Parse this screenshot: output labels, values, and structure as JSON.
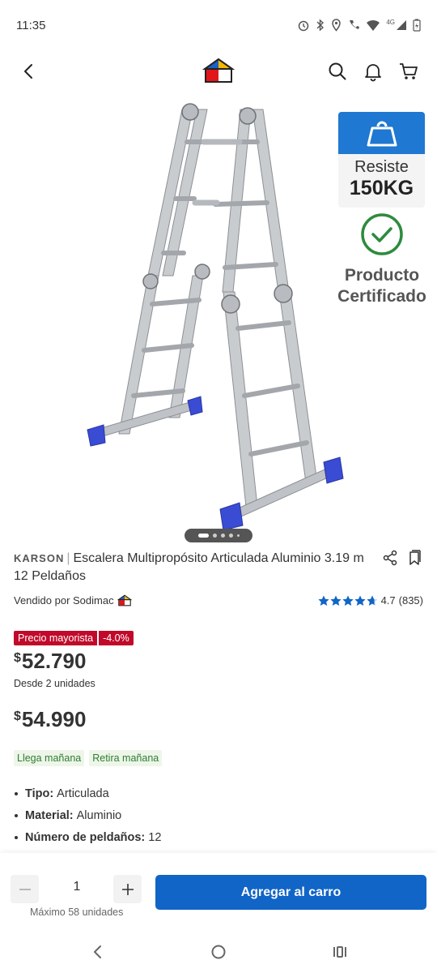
{
  "status_bar": {
    "time": "11:35",
    "network": "4G"
  },
  "header": {
    "back_icon": "chevron-left-icon",
    "logo": "sodimac-house-logo",
    "search_icon": "search-icon",
    "notifications_icon": "bell-icon",
    "cart_icon": "cart-icon"
  },
  "gallery": {
    "image": "aluminium-articulated-ladder",
    "slide_count": 5,
    "active_slide": 1
  },
  "badges": {
    "load_line1": "Resiste",
    "load_line2": "150KG",
    "certified_line1": "Producto",
    "certified_line2": "Certificado"
  },
  "product": {
    "brand": "KARSON",
    "separator": "|",
    "title": "Escalera Multipropósito Articulada Aluminio 3.19 m 12 Peldaños",
    "seller": "Vendido por Sodimac",
    "rating": "4.7",
    "reviews": "(835)",
    "rating_value": 4.7
  },
  "pricing": {
    "promo_label": "Precio mayorista",
    "discount": "-4.0%",
    "currency": "$",
    "wholesale_price": "52.790",
    "wholesale_note": "Desde 2 unidades",
    "regular_price": "54.990"
  },
  "delivery_tags": [
    "Llega mañana",
    "Retira mañana"
  ],
  "specs": [
    {
      "label": "Tipo:",
      "value": "Articulada"
    },
    {
      "label": "Material:",
      "value": "Aluminio"
    },
    {
      "label": "Número de peldaños:",
      "value": "12"
    }
  ],
  "purchase": {
    "quantity": "1",
    "max_units": "Máximo 58 unidades",
    "add_to_cart": "Agregar al carro"
  },
  "colors": {
    "primary_blue": "#1165c7",
    "badge_blue": "#1f78d1",
    "promo_red": "#c1092a",
    "delivery_green": "#2e7d32",
    "star_blue": "#1165c7"
  }
}
